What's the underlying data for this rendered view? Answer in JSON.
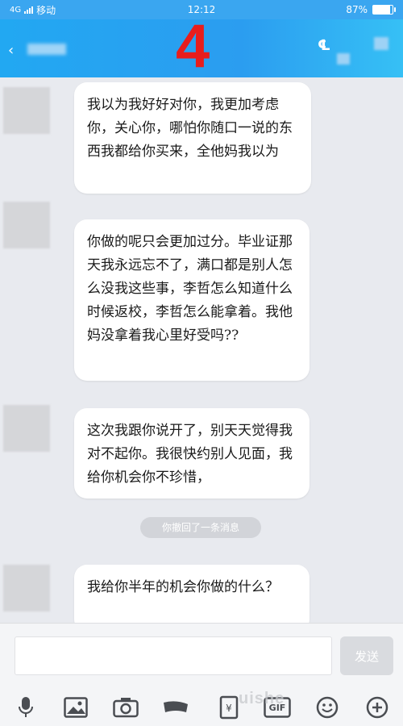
{
  "status_bar": {
    "signal": "4G",
    "carrier": "移动",
    "time": "12:12",
    "battery_percent": "87%",
    "battery_level": 0.87
  },
  "header": {
    "overlay_number": "4"
  },
  "messages": [
    {
      "text": "我以为我好好对你，我更加考虑你，关心你，哪怕你随口一说的东西我都给你买来，全他妈我以为"
    },
    {
      "text": "你做的呢只会更加过分。毕业证那天我永远忘不了，满口都是别人怎么没我这些事，李哲怎么知道什么时候返校，李哲怎么能拿着。我他妈没拿着我心里好受吗??"
    },
    {
      "text": "这次我跟你说开了，别天天觉得我对不起你。我很快约别人见面，我给你机会你不珍惜，"
    },
    {
      "text": "我给你半年的机会你做的什么？"
    }
  ],
  "recall_notice": "你撤回了一条消息",
  "input_bar": {
    "send_label": "发送"
  },
  "toolbar_icons": [
    "mic-icon",
    "image-icon",
    "camera-icon",
    "red-packet-icon",
    "file-icon",
    "gif-icon",
    "emoji-icon",
    "plus-icon"
  ],
  "watermark": "uishe"
}
